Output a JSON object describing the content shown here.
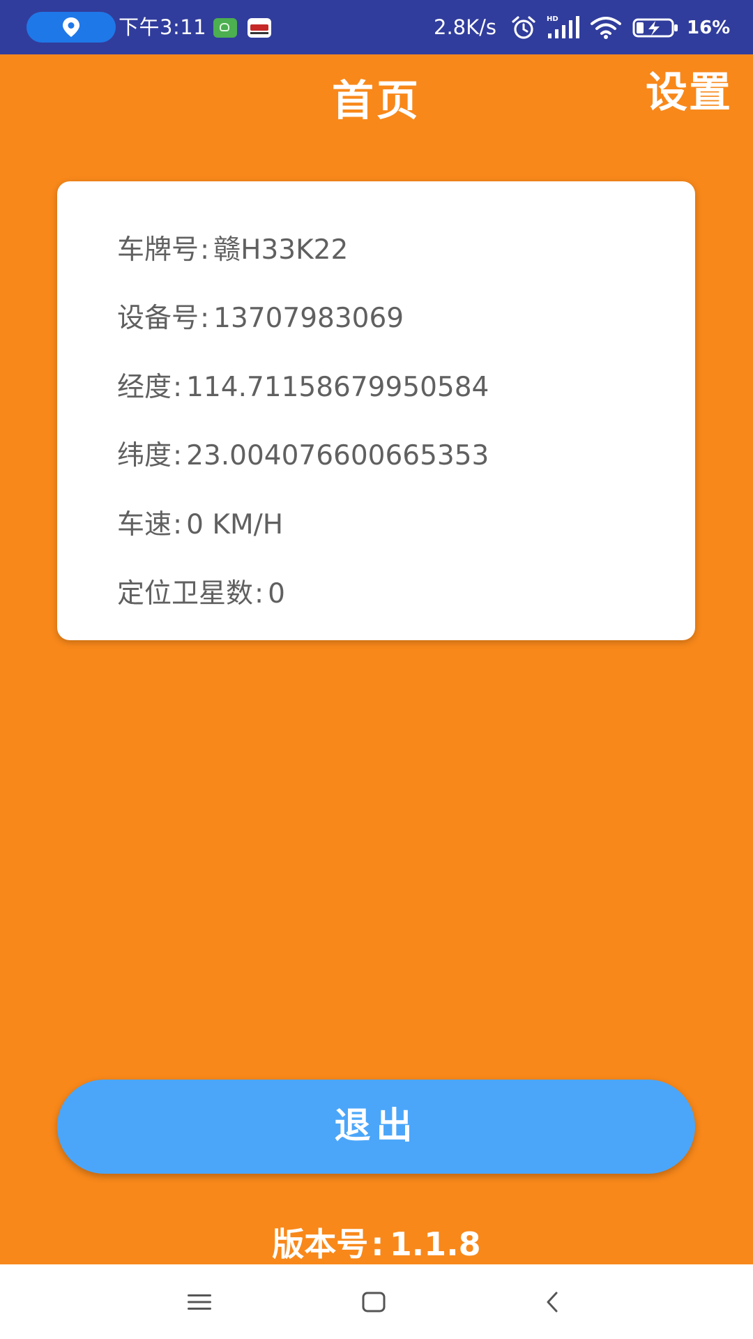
{
  "status_bar": {
    "time": "下午3:11",
    "network_speed": "2.8K/s",
    "battery_percent": "16%",
    "icons": [
      "location-icon",
      "app-notification-icon",
      "card-notification-icon",
      "alarm-icon",
      "hd-signal-icon",
      "wifi-icon",
      "battery-charging-icon"
    ]
  },
  "header": {
    "title": "首页",
    "settings_label": "设置"
  },
  "info_card": {
    "rows": [
      {
        "label": "车牌号",
        "value": "赣H33K22"
      },
      {
        "label": "设备号",
        "value": "13707983069"
      },
      {
        "label": "经度",
        "value": "114.71158679950584"
      },
      {
        "label": "纬度",
        "value": "23.004076600665353"
      },
      {
        "label": "车速",
        "value": "0 KM/H"
      },
      {
        "label": "定位卫星数",
        "value": "0"
      }
    ],
    "separator": ":"
  },
  "exit_button_label": "退出",
  "version": {
    "label": "版本号",
    "separator": ":",
    "value": "1.1.8"
  },
  "nav_bar": {
    "icons": [
      "menu-icon",
      "home-icon",
      "back-icon"
    ]
  },
  "colors": {
    "background": "#F8881A",
    "status_bar": "#313D9C",
    "exit_button": "#4BA6F9",
    "card": "#FFFFFF",
    "card_text": "#606060"
  }
}
